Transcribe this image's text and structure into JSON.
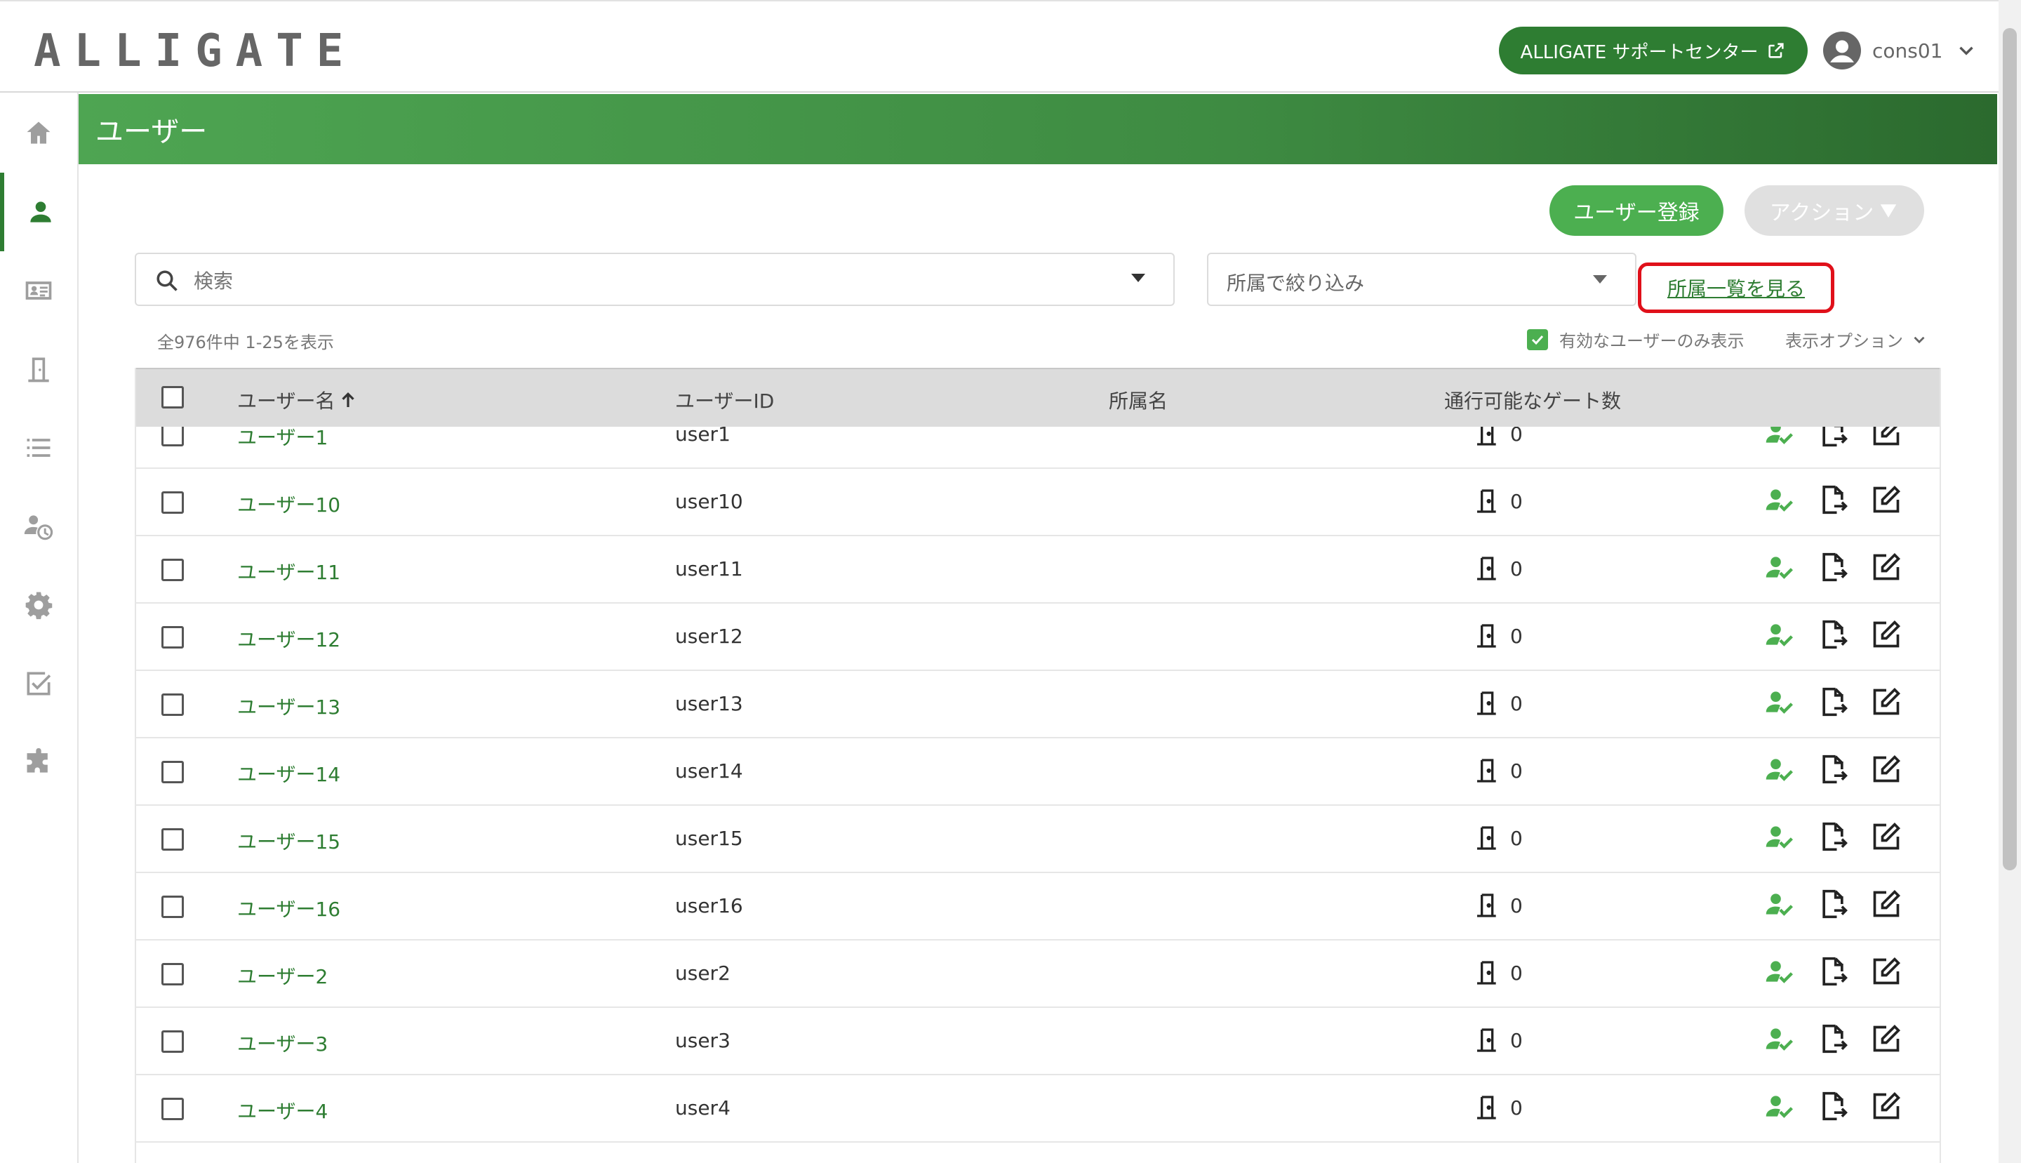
{
  "app": {
    "logo": "ALLIGATE",
    "support_label": "ALLIGATE サポートセンター",
    "account_name": "cons01"
  },
  "sidebar": {
    "items": [
      {
        "icon": "home-icon"
      },
      {
        "icon": "user-icon",
        "active": true
      },
      {
        "icon": "id-card-icon"
      },
      {
        "icon": "door-icon"
      },
      {
        "icon": "list-icon"
      },
      {
        "icon": "user-clock-icon"
      },
      {
        "icon": "gear-icon"
      },
      {
        "icon": "checkbox-icon"
      },
      {
        "icon": "puzzle-icon"
      }
    ]
  },
  "page": {
    "title": "ユーザー",
    "register_label": "ユーザー登録",
    "action_label": "アクション"
  },
  "search": {
    "placeholder": "検索"
  },
  "filter": {
    "placeholder": "所属で絞り込み",
    "affiliation_link": "所属一覧を見る"
  },
  "list": {
    "count_text": "全976件中 1-25を表示",
    "valid_only_label": "有効なユーザーのみ表示",
    "view_options_label": "表示オプション",
    "columns": {
      "name": "ユーザー名",
      "id": "ユーザーID",
      "affiliation": "所属名",
      "gates": "通行可能なゲート数"
    },
    "rows": [
      {
        "name": "ユーザー1",
        "id": "user1",
        "affiliation": "",
        "gates": "0"
      },
      {
        "name": "ユーザー10",
        "id": "user10",
        "affiliation": "",
        "gates": "0"
      },
      {
        "name": "ユーザー11",
        "id": "user11",
        "affiliation": "",
        "gates": "0"
      },
      {
        "name": "ユーザー12",
        "id": "user12",
        "affiliation": "",
        "gates": "0"
      },
      {
        "name": "ユーザー13",
        "id": "user13",
        "affiliation": "",
        "gates": "0"
      },
      {
        "name": "ユーザー14",
        "id": "user14",
        "affiliation": "",
        "gates": "0"
      },
      {
        "name": "ユーザー15",
        "id": "user15",
        "affiliation": "",
        "gates": "0"
      },
      {
        "name": "ユーザー16",
        "id": "user16",
        "affiliation": "",
        "gates": "0"
      },
      {
        "name": "ユーザー2",
        "id": "user2",
        "affiliation": "",
        "gates": "0"
      },
      {
        "name": "ユーザー3",
        "id": "user3",
        "affiliation": "",
        "gates": "0"
      },
      {
        "name": "ユーザー4",
        "id": "user4",
        "affiliation": "",
        "gates": "0"
      }
    ]
  },
  "colors": {
    "brand_green": "#2e7d32",
    "button_green": "#4caf50",
    "highlight_red": "#e0101a"
  }
}
